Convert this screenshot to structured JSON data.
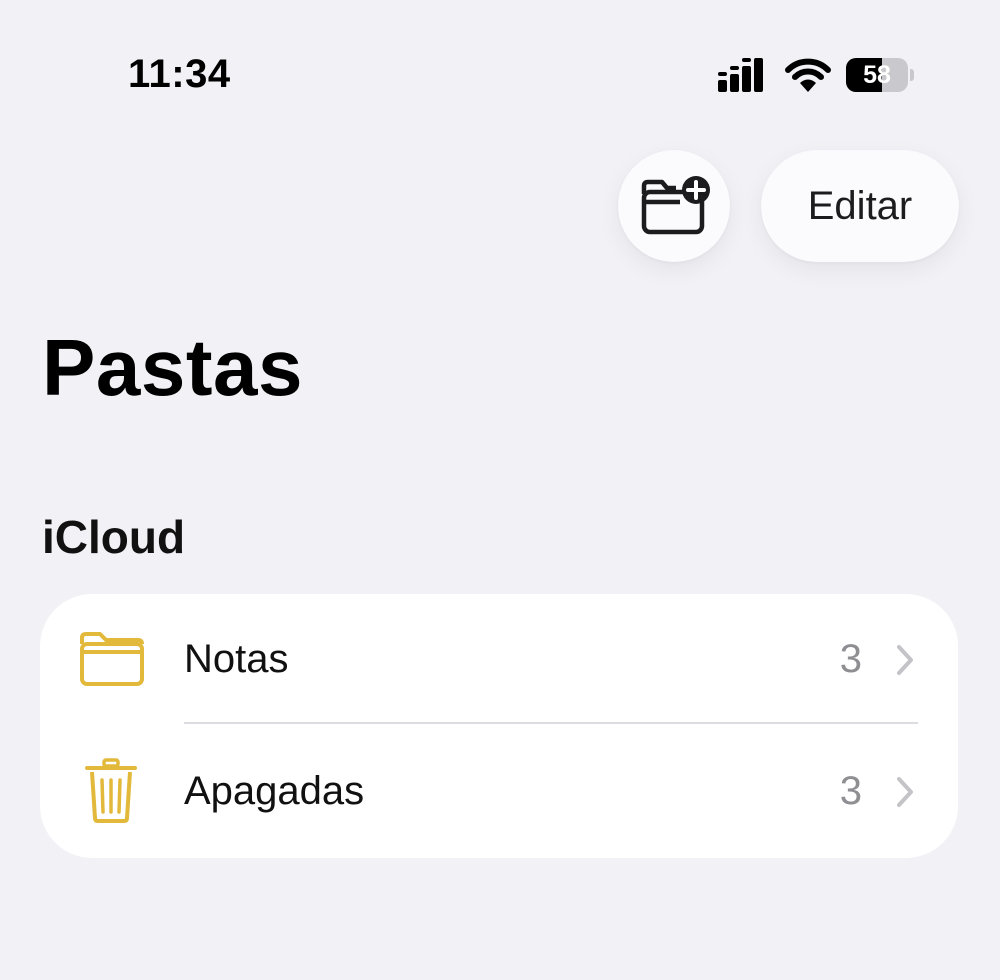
{
  "status_bar": {
    "time": "11:34",
    "battery_percent": 58,
    "signal_icon": "cellular-signal-icon",
    "wifi_icon": "wifi-icon"
  },
  "toolbar": {
    "new_folder_icon": "folder-plus-icon",
    "edit_label": "Editar"
  },
  "page": {
    "title": "Pastas"
  },
  "section": {
    "title": "iCloud",
    "items": [
      {
        "label": "Notas",
        "count": "3",
        "icon": "folder-icon"
      },
      {
        "label": "Apagadas",
        "count": "3",
        "icon": "trash-icon"
      }
    ]
  },
  "colors": {
    "background": "#F1F1F6",
    "card": "#FFFFFF",
    "accent_yellow": "#E2B93B",
    "secondary_text": "#8E8E93"
  }
}
